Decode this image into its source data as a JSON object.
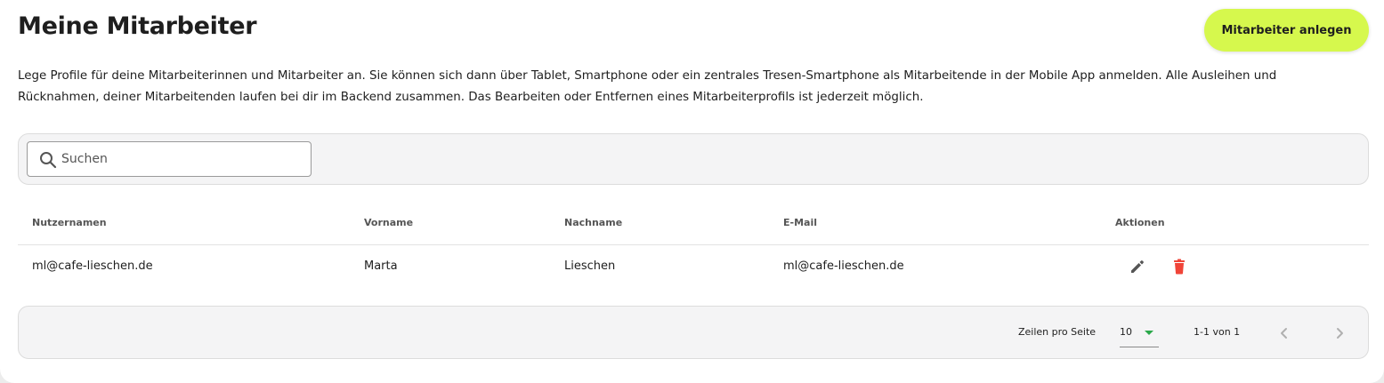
{
  "header": {
    "title": "Meine Mitarbeiter",
    "create_button_label": "Mitarbeiter anlegen",
    "description": "Lege Profile für deine Mitarbeiterinnen und Mitarbeiter an. Sie können sich dann über Tablet, Smartphone oder ein zentrales Tresen-Smartphone als Mitarbeitende in der Mobile App anmelden. Alle Ausleihen und Rücknahmen, deiner Mitarbeitenden laufen bei dir im Backend zusammen. Das Bearbeiten oder Entfernen eines Mitarbeiterprofils ist jederzeit möglich."
  },
  "search": {
    "placeholder": "Suchen",
    "value": "",
    "icon": "search-icon"
  },
  "table": {
    "columns": {
      "username": "Nutzernamen",
      "firstname": "Vorname",
      "lastname": "Nachname",
      "email": "E-Mail",
      "actions": "Aktionen"
    },
    "rows": [
      {
        "username": "ml@cafe-lieschen.de",
        "firstname": "Marta",
        "lastname": "Lieschen",
        "email": "ml@cafe-lieschen.de",
        "actions": [
          "edit-icon",
          "delete-icon"
        ]
      }
    ]
  },
  "pagination": {
    "rows_per_page_label": "Zeilen pro Seite",
    "rows_per_page_value": "10",
    "range_label": "1-1 von 1",
    "prev_icon": "chevron-left-icon",
    "next_icon": "chevron-right-icon"
  },
  "colors": {
    "accent": "#d6f84d",
    "delete": "#f04438",
    "edit": "#555555",
    "select_caret": "#2aa84a"
  }
}
